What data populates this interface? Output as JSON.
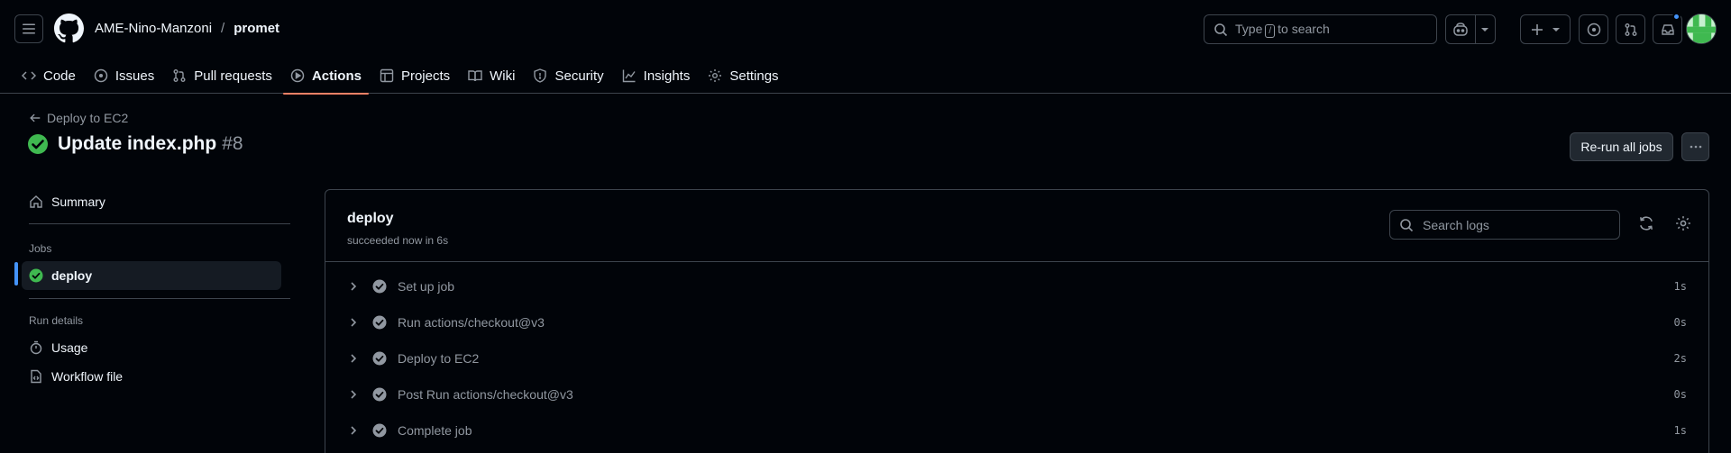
{
  "header": {
    "owner": "AME-Nino-Manzoni",
    "separator": "/",
    "repo": "promet",
    "search": {
      "prefix": "Type",
      "key": "/",
      "suffix": "to search"
    }
  },
  "nav": {
    "items": [
      {
        "label": "Code",
        "icon": "code-icon"
      },
      {
        "label": "Issues",
        "icon": "issue-icon"
      },
      {
        "label": "Pull requests",
        "icon": "pull-request-icon"
      },
      {
        "label": "Actions",
        "icon": "play-icon",
        "active": true
      },
      {
        "label": "Projects",
        "icon": "table-icon"
      },
      {
        "label": "Wiki",
        "icon": "book-icon"
      },
      {
        "label": "Security",
        "icon": "shield-icon"
      },
      {
        "label": "Insights",
        "icon": "graph-icon"
      },
      {
        "label": "Settings",
        "icon": "gear-icon"
      }
    ]
  },
  "run": {
    "back_label": "Deploy to EC2",
    "title": "Update index.php",
    "number": "#8",
    "rerun_label": "Re-run all jobs"
  },
  "sidebar": {
    "summary": "Summary",
    "jobs_heading": "Jobs",
    "job": "deploy",
    "run_details_heading": "Run details",
    "usage": "Usage",
    "workflow_file": "Workflow file"
  },
  "job": {
    "name": "deploy",
    "status": "succeeded now in 6s",
    "search_placeholder": "Search logs",
    "steps": [
      {
        "label": "Set up job",
        "duration": "1s"
      },
      {
        "label": "Run actions/checkout@v3",
        "duration": "0s"
      },
      {
        "label": "Deploy to EC2",
        "duration": "2s"
      },
      {
        "label": "Post Run actions/checkout@v3",
        "duration": "0s"
      },
      {
        "label": "Complete job",
        "duration": "1s"
      }
    ]
  },
  "colors": {
    "success": "#3fb950",
    "accent_underline": "#f78166",
    "link_blue": "#4493f8",
    "border": "#3d444d"
  }
}
